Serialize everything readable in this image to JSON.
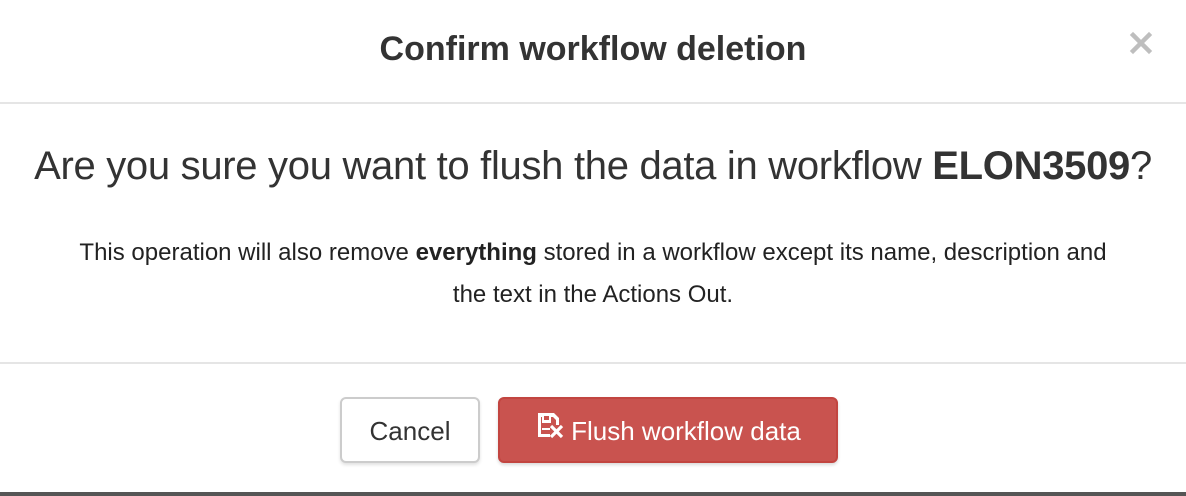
{
  "dialog": {
    "title": "Confirm workflow deletion",
    "close_icon": "close-icon",
    "question_prefix": "Are you sure you want to flush the data in workflow ",
    "workflow_name": "ELON3509",
    "question_suffix": "?",
    "note_prefix": "This operation will also remove ",
    "note_emphasis": "everything",
    "note_suffix": " stored in a workflow except its name, description and the text in the Actions Out.",
    "cancel_label": "Cancel",
    "flush_label": "Flush workflow data",
    "flush_icon": "save-remove-icon"
  },
  "colors": {
    "danger": "#c9534f",
    "border": "#e5e5e5",
    "text": "#333333"
  }
}
